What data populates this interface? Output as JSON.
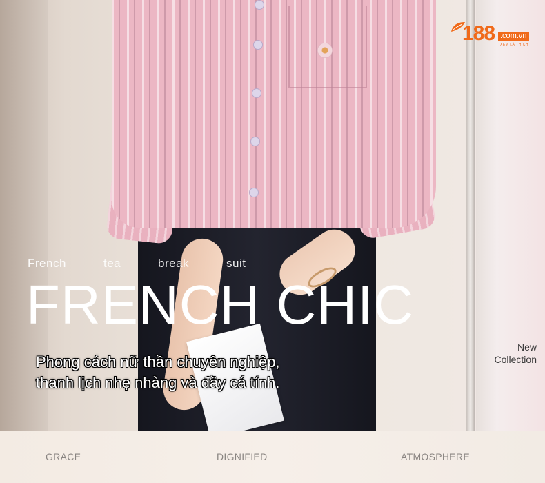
{
  "logo": {
    "number": "188",
    "domain": ".com.vn",
    "subtitle": "XEM LÀ THÍCH",
    "brand_color": "#f06a1a"
  },
  "tagline": {
    "words": [
      "French",
      "tea",
      "break",
      "suit"
    ]
  },
  "hero": {
    "title": "FRENCH CHIC"
  },
  "caption": {
    "line1": "Phong cách nữ thần chuyên nghiệp,",
    "line2": "thanh lịch nhẹ nhàng và đầy cá tính."
  },
  "new_collection": {
    "line1": "New",
    "line2": "Collection"
  },
  "footer": {
    "words": [
      "GRACE",
      "DIGNIFIED",
      "ATMOSPHERE"
    ]
  },
  "colors": {
    "shirt": "#ecb7c4",
    "pants": "#1a1b24",
    "text_light": "#ffffff",
    "footer_text": "#8a8582"
  }
}
